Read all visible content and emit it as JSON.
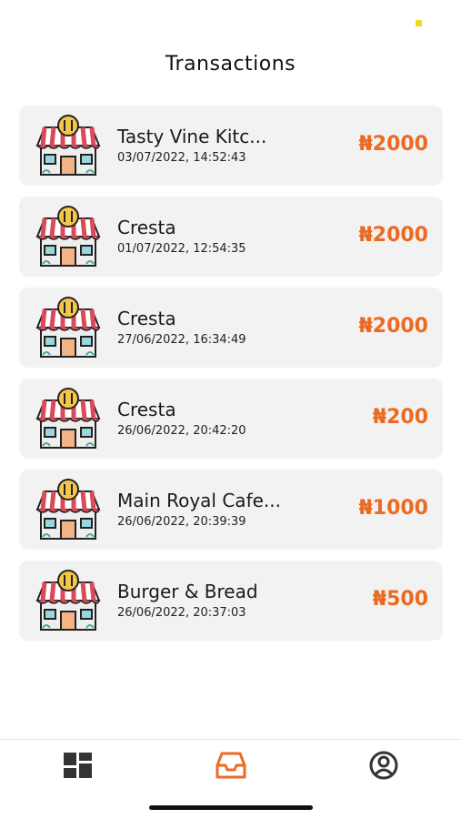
{
  "header": {
    "title": "Transactions"
  },
  "transactions": [
    {
      "merchant": "Tasty Vine Kitc...",
      "datetime": "03/07/2022, 14:52:43",
      "amount": "₦2000"
    },
    {
      "merchant": "Cresta",
      "datetime": "01/07/2022, 12:54:35",
      "amount": "₦2000"
    },
    {
      "merchant": "Cresta",
      "datetime": "27/06/2022, 16:34:49",
      "amount": "₦2000"
    },
    {
      "merchant": "Cresta",
      "datetime": "26/06/2022, 20:42:20",
      "amount": "₦200"
    },
    {
      "merchant": "Main Royal Cafe...",
      "datetime": "26/06/2022, 20:39:39",
      "amount": "₦1000"
    },
    {
      "merchant": "Burger & Bread",
      "datetime": "26/06/2022, 20:37:03",
      "amount": "₦500"
    }
  ],
  "icons": {
    "store": "restaurant-store-icon",
    "nav_dashboard": "dashboard-grid-icon",
    "nav_transactions": "inbox-tray-icon",
    "nav_profile": "user-circle-icon"
  },
  "nav": {
    "active": "transactions"
  },
  "colors": {
    "accent": "#ec6a22",
    "card_bg": "#f2f2f2",
    "text": "#1a1a1a",
    "inactive_icon": "#333333",
    "status_dot": "#f2d81c"
  }
}
